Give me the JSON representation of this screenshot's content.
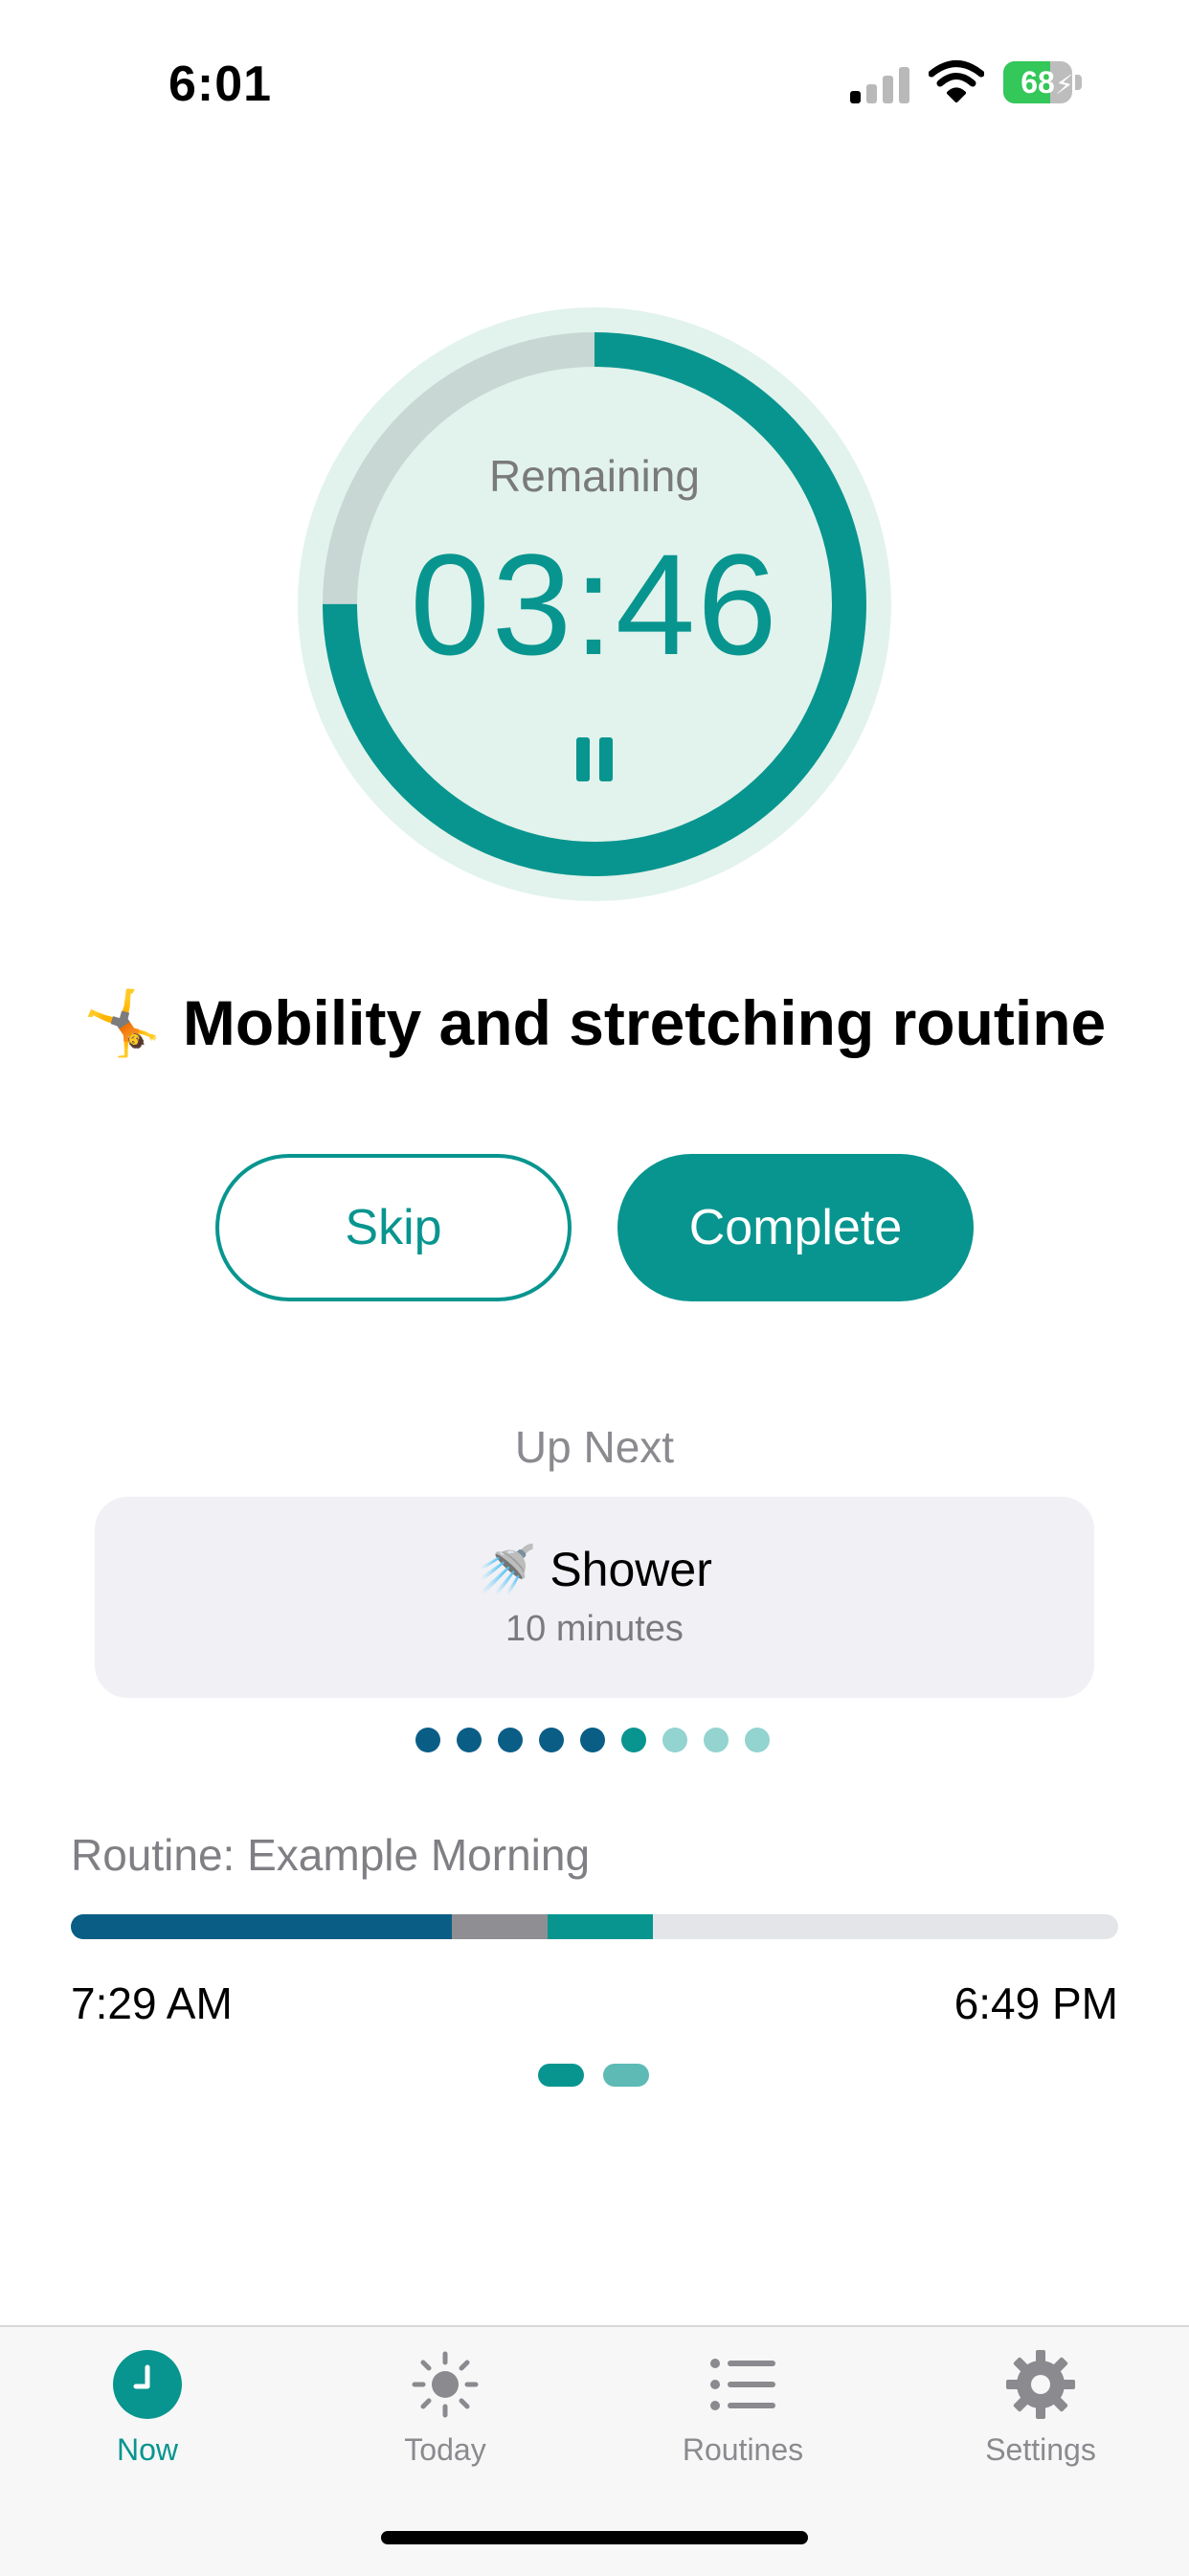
{
  "status_bar": {
    "time": "6:01",
    "battery_level": "68",
    "battery_charging": true,
    "signal_bars_active": 1
  },
  "timer": {
    "label": "Remaining",
    "value": "03:46",
    "progress_remaining_fraction": 0.75,
    "pause_icon": "pause-icon"
  },
  "task": {
    "emoji": "🤸",
    "title": "Mobility and stretching routine"
  },
  "actions": {
    "skip_label": "Skip",
    "complete_label": "Complete"
  },
  "up_next": {
    "label": "Up Next",
    "emoji": "🚿",
    "title": "Shower",
    "duration": "10 minutes",
    "steps_total": 9,
    "steps_completed": 5,
    "current_step": 6
  },
  "routine": {
    "label": "Routine: Example Morning",
    "start_time": "7:29 AM",
    "end_time": "6:49 PM",
    "segments": [
      {
        "name": "completed",
        "fraction": 0.364,
        "color": "#0a5e86"
      },
      {
        "name": "skipped",
        "fraction": 0.091,
        "color": "#8e8e93"
      },
      {
        "name": "current",
        "fraction": 0.101,
        "color": "#08958f"
      }
    ]
  },
  "pager": {
    "pages": 2,
    "active": 1
  },
  "tabs": [
    {
      "label": "Now",
      "icon": "clock-icon",
      "active": true
    },
    {
      "label": "Today",
      "icon": "sun-icon",
      "active": false
    },
    {
      "label": "Routines",
      "icon": "list-icon",
      "active": false
    },
    {
      "label": "Settings",
      "icon": "gear-icon",
      "active": false
    }
  ],
  "colors": {
    "accent": "#08958f",
    "completed": "#0a5e86",
    "ring_background": "#e1f3ec",
    "ring_track": "#c8d6d4"
  }
}
